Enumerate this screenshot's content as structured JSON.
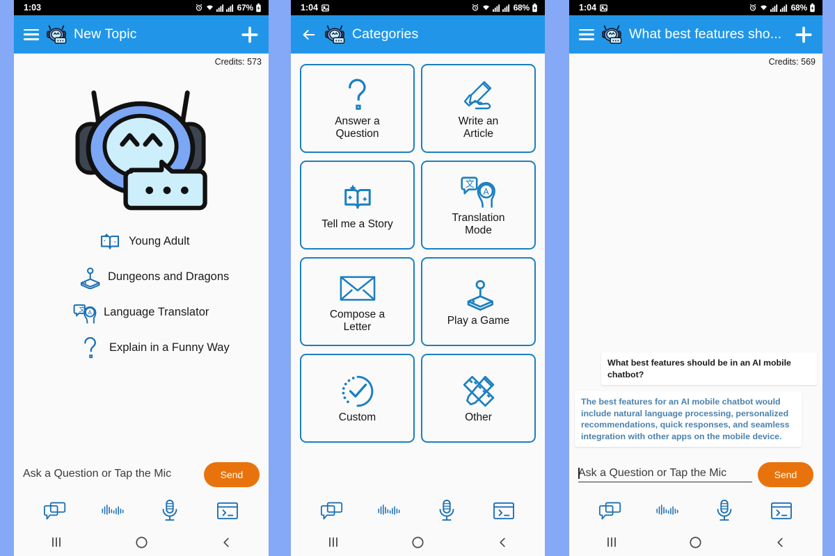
{
  "theme": {
    "header_blue": "#2196e8",
    "icon_blue": "#1a7fc1",
    "accent_orange": "#e8730d",
    "page_background": "#85a8f7",
    "bot_text_blue": "#4a82ae"
  },
  "panel1": {
    "status": {
      "time": "1:03",
      "battery": "67%"
    },
    "appbar": {
      "title": "New Topic",
      "menu_icon": "hamburger-icon",
      "logo_icon": "chatbot-logo-icon",
      "add_icon": "plus-icon"
    },
    "credits": "Credits: 573",
    "mascot_icon": "chatbot-mascot-icon",
    "topics": [
      {
        "label": "Young Adult",
        "icon": "open-book-icon"
      },
      {
        "label": "Dungeons and Dragons",
        "icon": "joystick-icon"
      },
      {
        "label": "Language Translator",
        "icon": "translate-head-icon"
      },
      {
        "label": "Explain in a Funny Way",
        "icon": "question-mark-icon"
      }
    ],
    "input": {
      "placeholder": "Ask a Question or Tap the Mic",
      "value": "",
      "send_label": "Send",
      "focused": false
    },
    "tools": [
      "chat-bubbles-icon",
      "waveform-icon",
      "microphone-icon",
      "terminal-icon"
    ],
    "nav": [
      "recents-icon",
      "home-icon",
      "back-icon"
    ]
  },
  "panel2": {
    "status": {
      "time": "1:04",
      "battery": "68%",
      "extra_icon": "screenshot-icon"
    },
    "appbar": {
      "title": "Categories",
      "back_icon": "back-arrow-icon",
      "logo_icon": "chatbot-logo-icon"
    },
    "categories": [
      {
        "label": "Answer a\nQuestion",
        "icon": "question-mark-icon"
      },
      {
        "label": "Write an\nArticle",
        "icon": "writing-hand-icon"
      },
      {
        "label": "Tell me a Story",
        "icon": "open-book-icon"
      },
      {
        "label": "Translation\nMode",
        "icon": "translate-head-icon"
      },
      {
        "label": "Compose a\nLetter",
        "icon": "envelope-icon"
      },
      {
        "label": "Play a Game",
        "icon": "joystick-icon"
      },
      {
        "label": "Custom",
        "icon": "check-circle-dotted-icon"
      },
      {
        "label": "Other",
        "icon": "pencil-ruler-icon"
      }
    ],
    "nav": [
      "recents-icon",
      "home-icon",
      "back-icon"
    ]
  },
  "panel3": {
    "status": {
      "time": "1:04",
      "battery": "68%",
      "extra_icon": "screenshot-icon"
    },
    "appbar": {
      "title": "What best features sho...",
      "menu_icon": "hamburger-icon",
      "logo_icon": "chatbot-logo-icon",
      "add_icon": "plus-icon"
    },
    "credits": "Credits: 569",
    "messages": [
      {
        "from": "user",
        "text": "What best features should be in an AI mobile chatbot?"
      },
      {
        "from": "bot",
        "text": "The best features for an AI mobile chatbot would include natural language processing, personalized recommendations, quick responses, and seamless integration with other apps on the mobile device."
      }
    ],
    "input": {
      "placeholder": "Ask a Question or Tap the Mic",
      "value": "",
      "send_label": "Send",
      "focused": true
    },
    "tools": [
      "chat-bubbles-icon",
      "waveform-icon",
      "microphone-icon",
      "terminal-icon"
    ],
    "nav": [
      "recents-icon",
      "home-icon",
      "back-icon"
    ]
  }
}
